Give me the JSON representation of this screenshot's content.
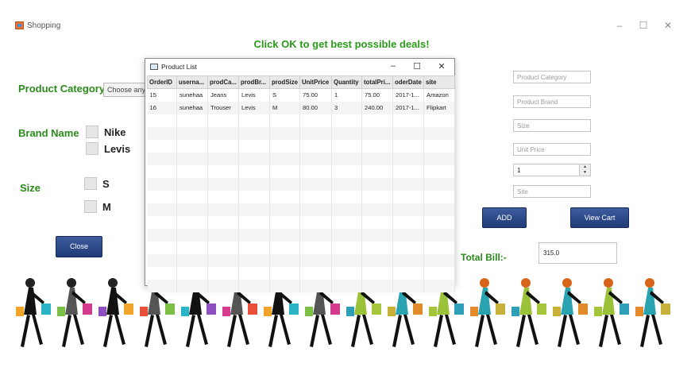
{
  "window": {
    "title": "Shopping",
    "minimize": "–",
    "maximize": "☐",
    "close": "✕"
  },
  "headline": "Click OK to get best possible deals!",
  "category": {
    "label": "Product Category",
    "combo_text": "Choose any c"
  },
  "brand": {
    "label": "Brand Name",
    "options": [
      "Nike",
      "Levis"
    ]
  },
  "size": {
    "label": "Size",
    "options": [
      "S",
      "M"
    ]
  },
  "buttons": {
    "close": "Close",
    "add": "ADD",
    "view_cart": "View Cart"
  },
  "fields": {
    "category_placeholder": "Product Category",
    "brand_placeholder": "Product Brand",
    "size_placeholder": "Size",
    "price_placeholder": "Unit Price",
    "quantity_value": "1",
    "site_placeholder": "Site"
  },
  "total": {
    "label": "Total Bill:-",
    "value": "315.0"
  },
  "product_list": {
    "title": "Product List",
    "minimize": "–",
    "maximize": "☐",
    "close": "✕",
    "columns": [
      "OrderID",
      "userna...",
      "prodCa...",
      "prodBr...",
      "prodSize",
      "UnitPrice",
      "Quantity",
      "totalPri...",
      "oderDate",
      "site"
    ],
    "rows": [
      [
        "15",
        "sunehaa",
        "Jeans",
        "Levis",
        "S",
        "75.00",
        "1",
        "75.00",
        "2017-1...",
        "Amazon"
      ],
      [
        "16",
        "sunehaa",
        "Trouser",
        "Levis",
        "M",
        "80.00",
        "3",
        "240.00",
        "2017-1...",
        "Flipkart"
      ]
    ]
  },
  "colors": {
    "label_green": "#2a8a1a",
    "headline_green": "#2a9a1a",
    "button_blue": "#1f3b78"
  }
}
